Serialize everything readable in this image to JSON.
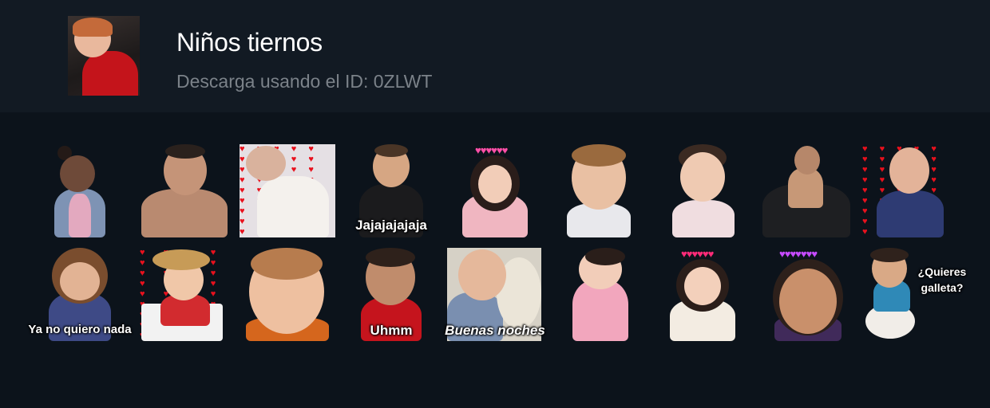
{
  "pack": {
    "title": "Niños tiernos",
    "subtitle": "Descarga usando el ID: 0ZLWT",
    "cover_icon": "child-photo"
  },
  "stickers": [
    {
      "caption": ""
    },
    {
      "caption": ""
    },
    {
      "caption": ""
    },
    {
      "caption": "Jajajajajaja"
    },
    {
      "caption": ""
    },
    {
      "caption": ""
    },
    {
      "caption": ""
    },
    {
      "caption": ""
    },
    {
      "caption": ""
    },
    {
      "caption": "Ya no quiero nada"
    },
    {
      "caption": ""
    },
    {
      "caption": ""
    },
    {
      "caption": "Uhmm"
    },
    {
      "caption": "Buenas noches"
    },
    {
      "caption": ""
    },
    {
      "caption": ""
    },
    {
      "caption": ""
    },
    {
      "caption": "¿Quieres galleta?"
    }
  ],
  "colors": {
    "background": "#0c131b",
    "header": "#121a23",
    "title": "#ffffff",
    "subtitle": "#7b8289",
    "heart": "#e8111d"
  }
}
